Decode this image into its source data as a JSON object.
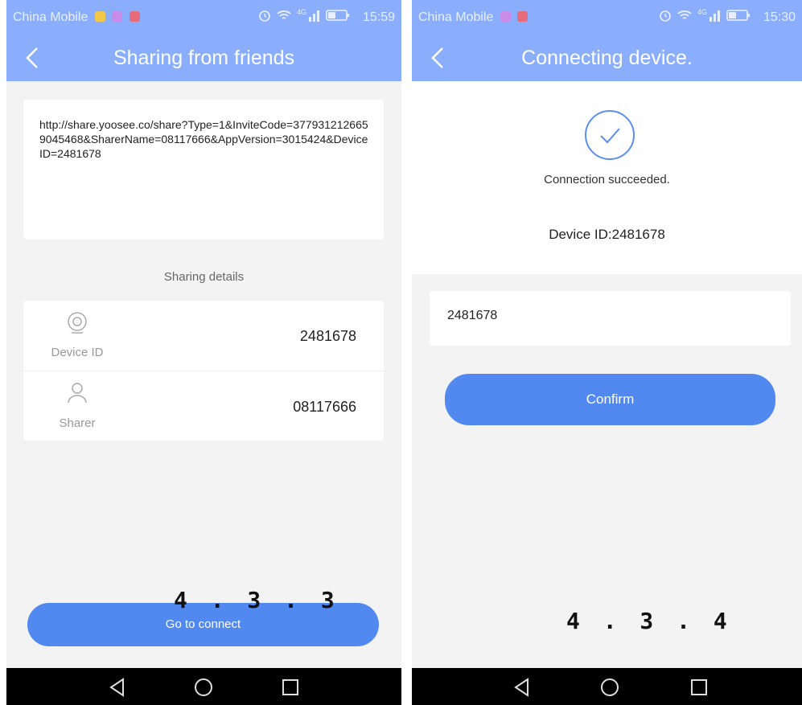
{
  "screen1": {
    "status": {
      "carrier": "China Mobile",
      "time": "15:59",
      "network": "4G"
    },
    "title": "Sharing from friends",
    "share_url": "http://share.yoosee.co/share?Type=1&InviteCode=3779312126659045468&SharerName=08117666&AppVersion=3015424&DeviceID=2481678",
    "section_label": "Sharing details",
    "details": [
      {
        "icon": "camera-icon",
        "label": "Device ID",
        "value": "2481678"
      },
      {
        "icon": "person-icon",
        "label": "Sharer",
        "value": "08117666"
      }
    ],
    "button_label": "Go to connect",
    "stamp": "4.3.3"
  },
  "screen2": {
    "status": {
      "carrier": "China Mobile",
      "time": "15:30",
      "network": "4G"
    },
    "title": "Connecting device.",
    "success_text": "Connection succeeded.",
    "device_id_text": "Device ID:2481678",
    "input_value": "2481678",
    "button_label": "Confirm",
    "stamp": "4.3.4"
  },
  "colors": {
    "header": "#8aaefb",
    "button": "#5189f1",
    "background": "#f3f3f3"
  }
}
